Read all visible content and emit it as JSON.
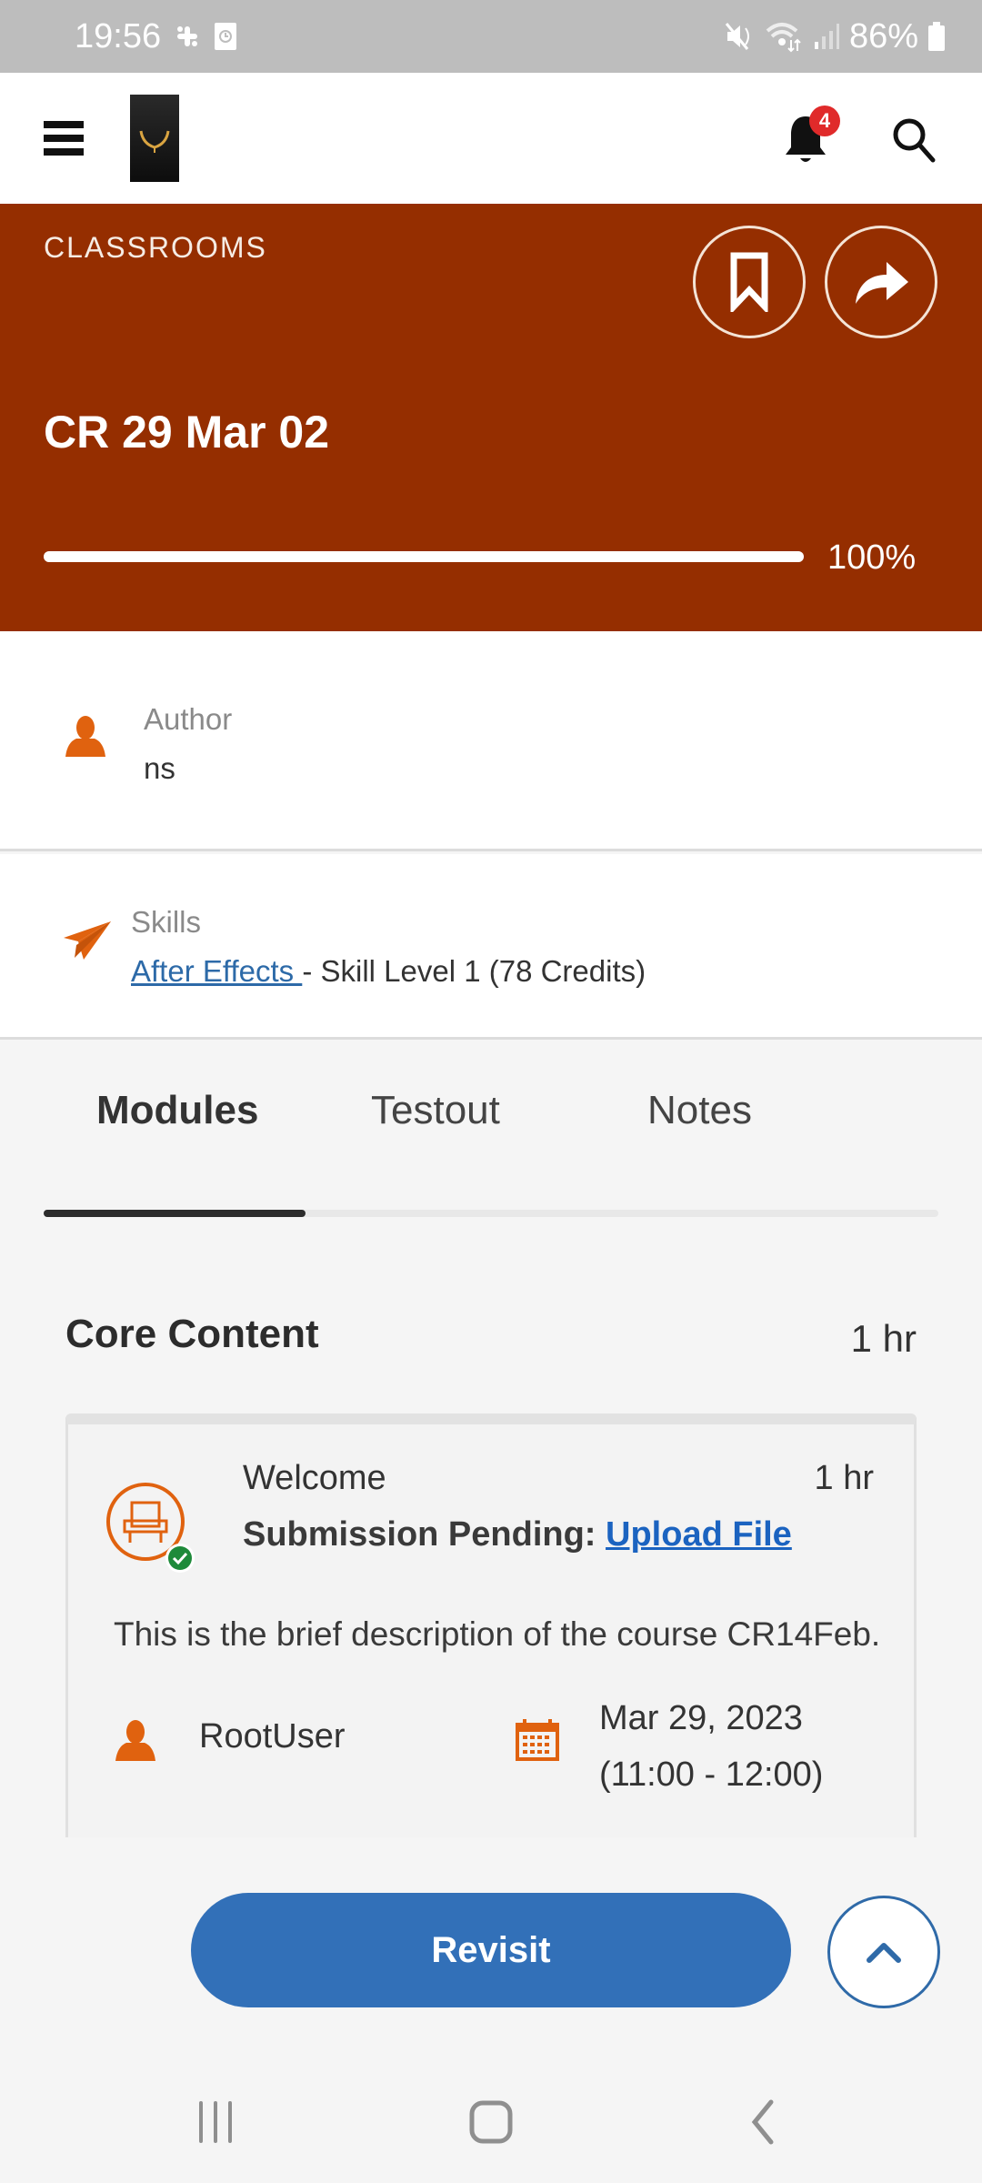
{
  "status_bar": {
    "time": "19:56",
    "battery": "86%",
    "icons": [
      "slack-icon",
      "clock-app-icon",
      "mute-icon",
      "wifi-icon",
      "signal-icon",
      "battery-icon"
    ]
  },
  "header": {
    "notification_count": "4",
    "icons": [
      "menu-icon",
      "app-logo",
      "bell-icon",
      "search-icon"
    ]
  },
  "hero": {
    "category": "CLASSROOMS",
    "title": "CR 29 Mar 02",
    "progress_percent": 100,
    "progress_label": "100%",
    "background_color": "#952e00"
  },
  "author": {
    "label": "Author",
    "name": "ns"
  },
  "skills": {
    "label": "Skills",
    "skill_name": "After Effects ",
    "skill_detail": "- Skill Level 1 (78 Credits)"
  },
  "tabs": [
    {
      "label": "Modules",
      "active": true
    },
    {
      "label": "Testout",
      "active": false
    },
    {
      "label": "Notes",
      "active": false
    }
  ],
  "section": {
    "title": "Core Content",
    "duration": "1 hr"
  },
  "module": {
    "title": "Welcome",
    "duration": "1 hr",
    "status_label": "Submission Pending:",
    "action_link": "Upload File",
    "description": "This is the brief description of the course CR14Feb.",
    "instructor": "RootUser",
    "date": "Mar 29, 2023",
    "time": "(11:00 - 12:00)",
    "accent_color": "#e0620f"
  },
  "actions": {
    "revisit_label": "Revisit",
    "primary_color": "#3270b8"
  }
}
